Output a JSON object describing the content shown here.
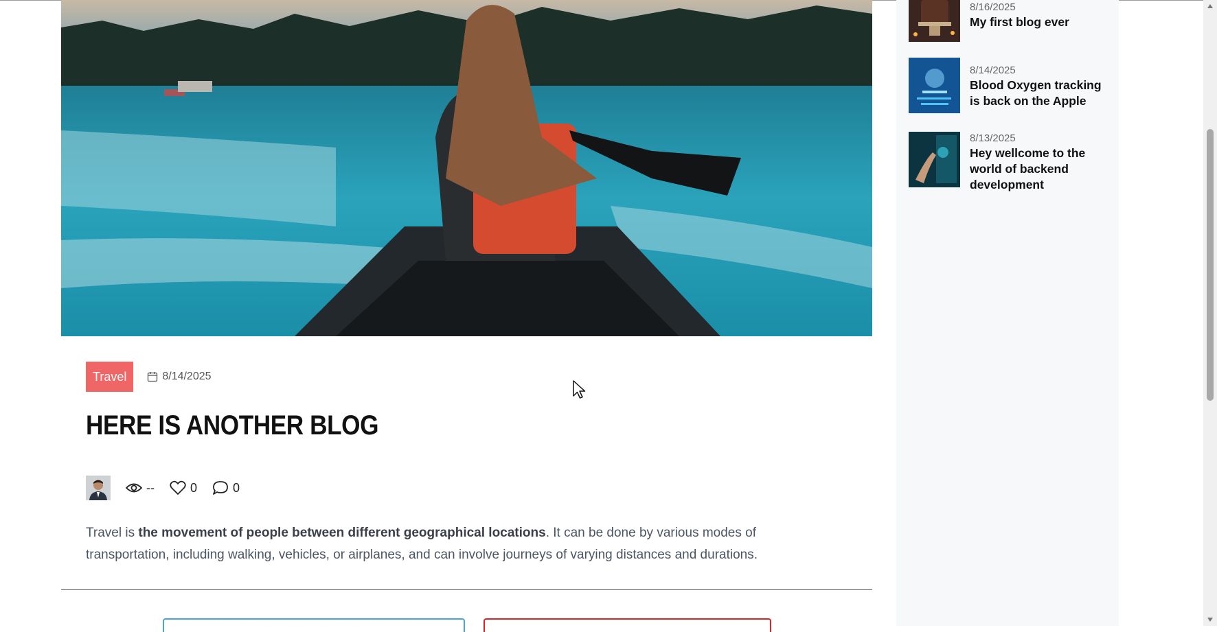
{
  "post": {
    "category": "Travel",
    "date": "8/14/2025",
    "title": "HERE IS ANOTHER BLOG",
    "views": "--",
    "likes": "0",
    "comments": "0",
    "excerpt_lead": "Travel is ",
    "excerpt_bold": "the movement of people between different geographical locations",
    "excerpt_rest": ". It can be done by various modes of transportation, including walking, vehicles, or airplanes, and can involve journeys of varying distances and durations.",
    "hero_icon": "canoe-lake-photo"
  },
  "sidebar": {
    "items": [
      {
        "date": "8/16/2025",
        "title": "My first blog ever",
        "thumb": "cake-thumbnail"
      },
      {
        "date": "8/14/2025",
        "title": "Blood Oxygen tracking is back on the Apple",
        "thumb": "tech-face-thumbnail"
      },
      {
        "date": "8/13/2025",
        "title": "Hey wellcome to the world of backend development",
        "thumb": "digital-hand-thumbnail"
      }
    ]
  },
  "colors": {
    "badge": "#f06565",
    "sidebar_bg": "#f7f8fa",
    "button_blue": "#4aa3df",
    "button_red": "#d9252a"
  }
}
